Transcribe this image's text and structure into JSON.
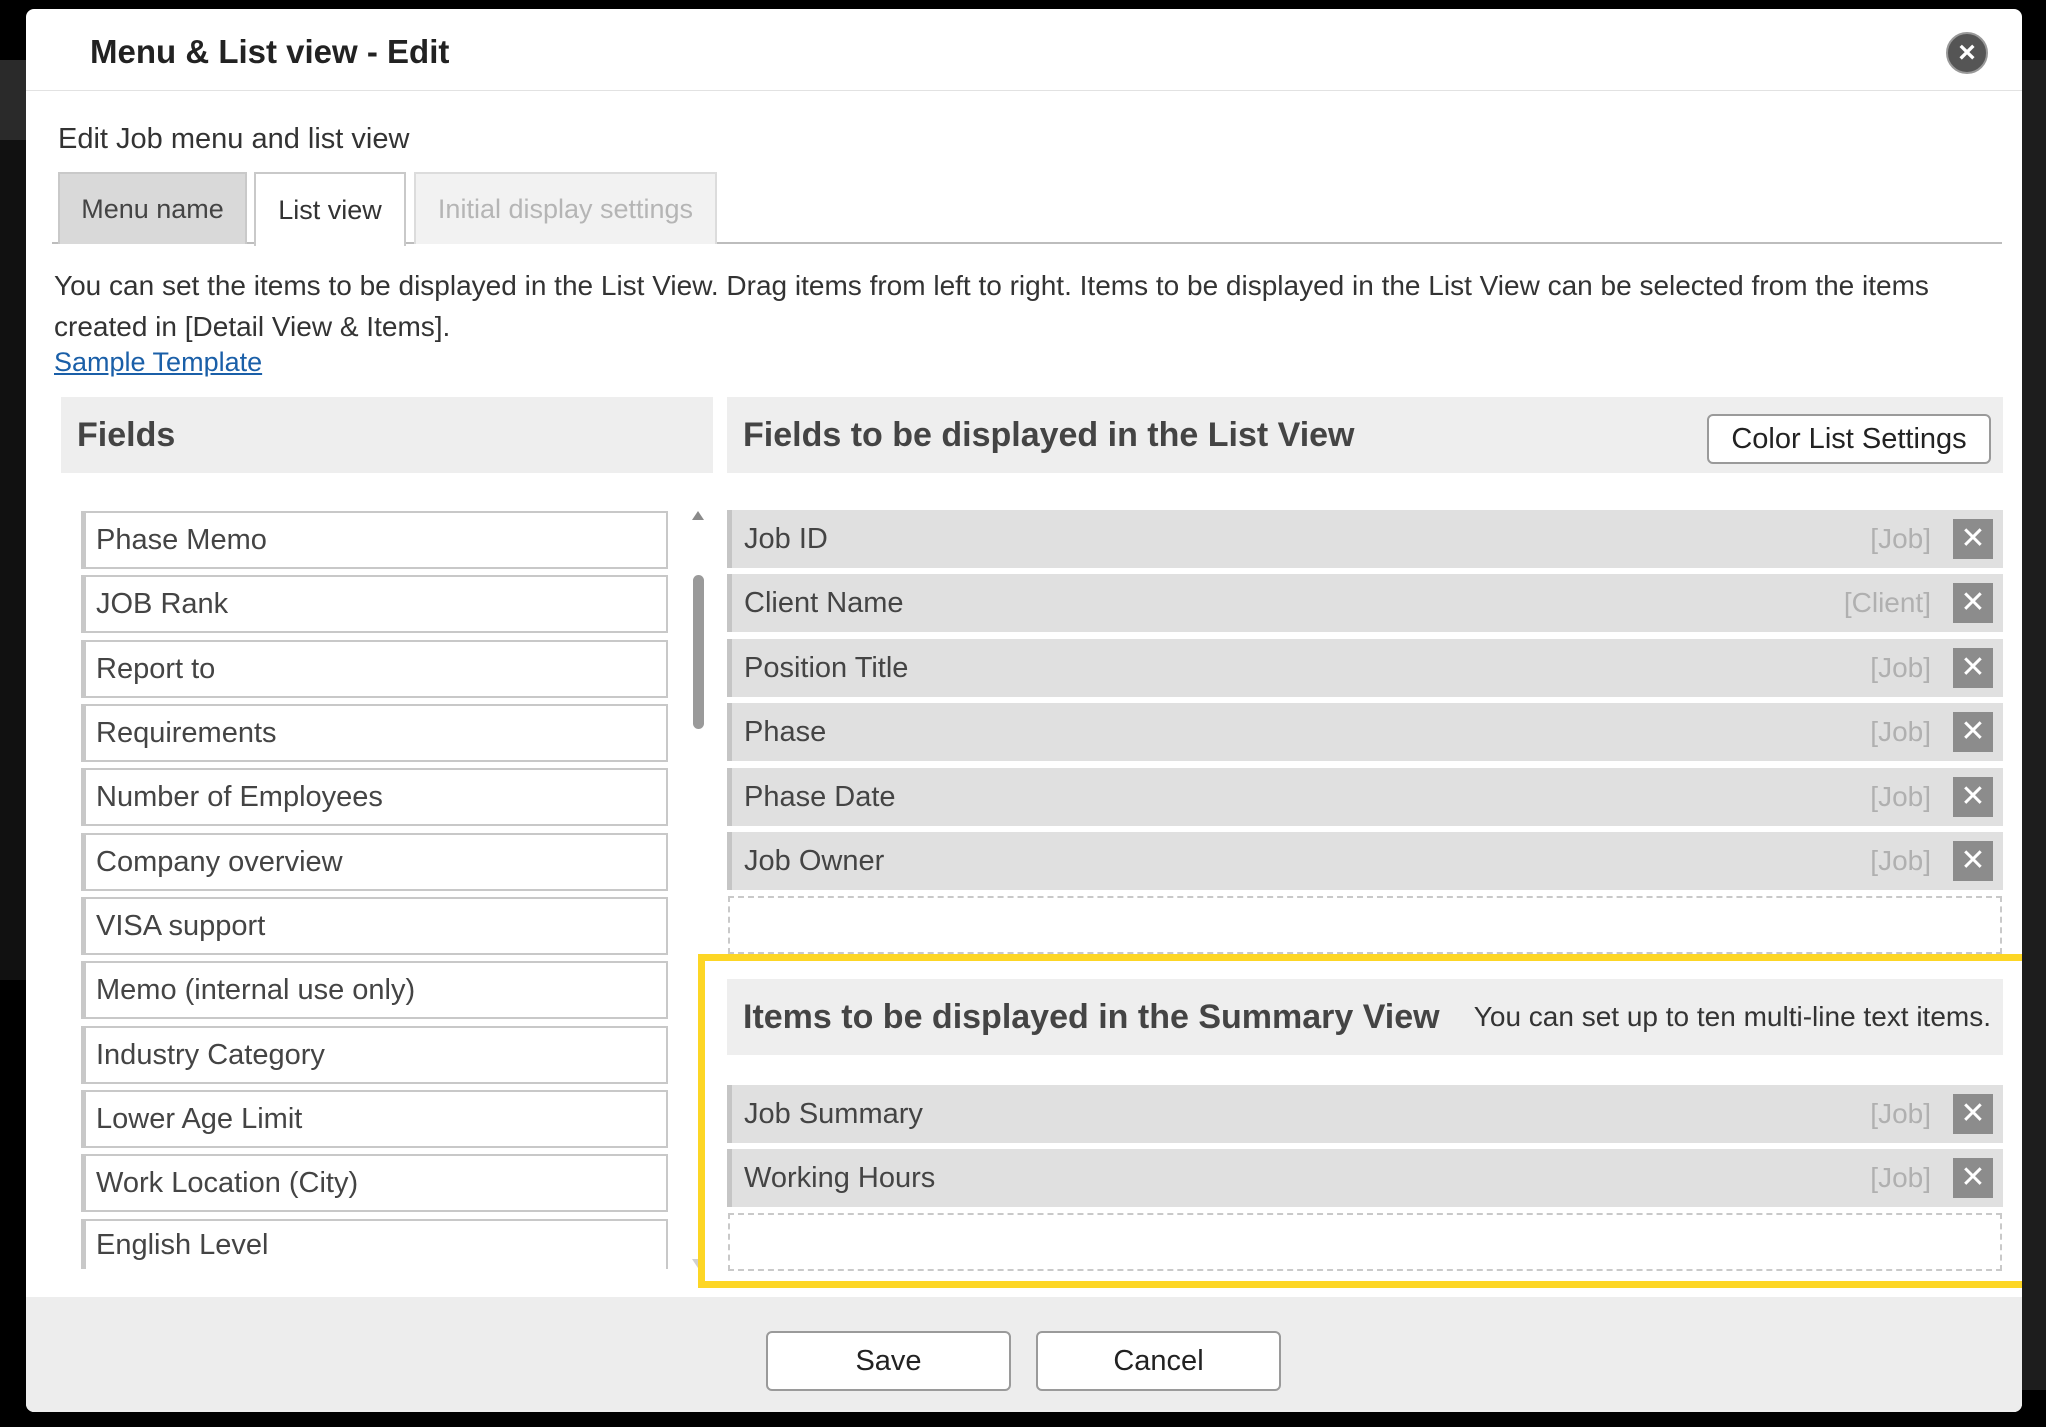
{
  "modal": {
    "title": "Menu & List view - Edit",
    "close_glyph": "×",
    "subtitle": "Edit Job menu and list view"
  },
  "tabs": [
    {
      "label": "Menu name"
    },
    {
      "label": "List view",
      "active": true
    },
    {
      "label": "Initial display settings",
      "disabled": true
    }
  ],
  "description": "You can set the items to be displayed in the List View. Drag items from left to right. Items to be displayed in the List View can be selected from the items created in [Detail View & Items].",
  "sample_link": "Sample Template",
  "fields_panel": {
    "title": "Fields",
    "items": [
      "Phase Memo",
      "JOB Rank",
      "Report to",
      "Requirements",
      "Number of Employees",
      "Company overview",
      "VISA support",
      "Memo (internal use only)",
      "Industry Category",
      "Lower Age Limit",
      "Work Location (City)",
      "English Level"
    ]
  },
  "list_view_panel": {
    "title": "Fields to be displayed in the List View",
    "color_button": "Color List Settings",
    "items": [
      {
        "label": "Job ID",
        "tag": "[Job]"
      },
      {
        "label": "Client Name",
        "tag": "[Client]"
      },
      {
        "label": "Position Title",
        "tag": "[Job]"
      },
      {
        "label": "Phase",
        "tag": "[Job]"
      },
      {
        "label": "Phase Date",
        "tag": "[Job]"
      },
      {
        "label": "Job Owner",
        "tag": "[Job]"
      }
    ],
    "remove_glyph": "✕"
  },
  "summary_panel": {
    "title": "Items to be displayed in the Summary View",
    "note": "You can set up to ten multi-line text items.",
    "items": [
      {
        "label": "Job Summary",
        "tag": "[Job]"
      },
      {
        "label": "Working Hours",
        "tag": "[Job]"
      }
    ]
  },
  "footer": {
    "save": "Save",
    "cancel": "Cancel"
  },
  "colors": {
    "highlight": "#fdd625",
    "link": "#1a5fa8"
  }
}
